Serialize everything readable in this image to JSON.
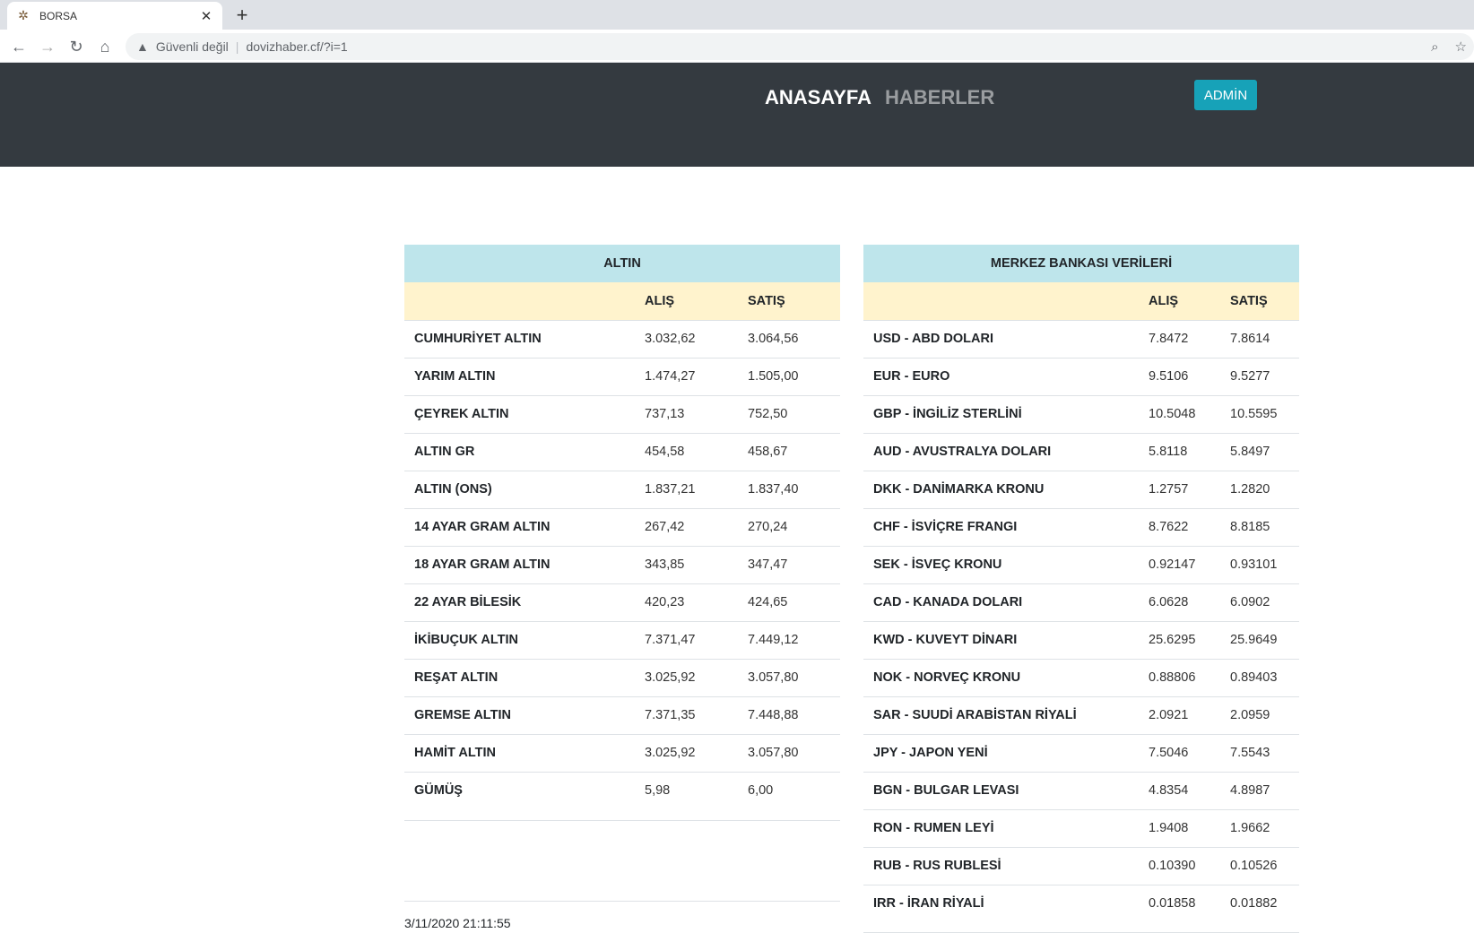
{
  "browser": {
    "tab_title": "BORSA",
    "security_label": "Güvenli değil",
    "url": "dovizhaber.cf/?i=1"
  },
  "nav": {
    "home": "ANASAYFA",
    "news": "HABERLER",
    "admin": "ADMİN"
  },
  "gold": {
    "title": "ALTIN",
    "buy_header": "ALIŞ",
    "sell_header": "SATIŞ",
    "rows": [
      {
        "name": "CUMHURİYET ALTIN",
        "buy": "3.032,62",
        "sell": "3.064,56"
      },
      {
        "name": "YARIM ALTIN",
        "buy": "1.474,27",
        "sell": "1.505,00"
      },
      {
        "name": "ÇEYREK ALTIN",
        "buy": "737,13",
        "sell": "752,50"
      },
      {
        "name": "ALTIN GR",
        "buy": "454,58",
        "sell": "458,67"
      },
      {
        "name": "ALTIN (ONS)",
        "buy": "1.837,21",
        "sell": "1.837,40"
      },
      {
        "name": "14 AYAR GRAM ALTIN",
        "buy": "267,42",
        "sell": "270,24"
      },
      {
        "name": "18 AYAR GRAM ALTIN",
        "buy": "343,85",
        "sell": "347,47"
      },
      {
        "name": "22 AYAR BİLESİK",
        "buy": "420,23",
        "sell": "424,65"
      },
      {
        "name": "İKİBUÇUK ALTIN",
        "buy": "7.371,47",
        "sell": "7.449,12"
      },
      {
        "name": "REŞAT ALTIN",
        "buy": "3.025,92",
        "sell": "3.057,80"
      },
      {
        "name": "GREMSE ALTIN",
        "buy": "7.371,35",
        "sell": "7.448,88"
      },
      {
        "name": "HAMİT ALTIN",
        "buy": "3.025,92",
        "sell": "3.057,80"
      },
      {
        "name": "GÜMÜŞ",
        "buy": "5,98",
        "sell": "6,00"
      }
    ],
    "timestamp": "3/11/2020 21:11:55"
  },
  "central_bank": {
    "title": "MERKEZ BANKASI VERİLERİ",
    "buy_header": "ALIŞ",
    "sell_header": "SATIŞ",
    "rows": [
      {
        "name": "USD - ABD DOLARI",
        "buy": "7.8472",
        "sell": "7.8614"
      },
      {
        "name": "EUR - EURO",
        "buy": "9.5106",
        "sell": "9.5277"
      },
      {
        "name": "GBP - İNGİLİZ STERLİNİ",
        "buy": "10.5048",
        "sell": "10.5595"
      },
      {
        "name": "AUD - AVUSTRALYA DOLARI",
        "buy": "5.8118",
        "sell": "5.8497"
      },
      {
        "name": "DKK - DANİMARKA KRONU",
        "buy": "1.2757",
        "sell": "1.2820"
      },
      {
        "name": "CHF - İSVİÇRE FRANGI",
        "buy": "8.7622",
        "sell": "8.8185"
      },
      {
        "name": "SEK - İSVEÇ KRONU",
        "buy": "0.92147",
        "sell": "0.93101"
      },
      {
        "name": "CAD - KANADA DOLARI",
        "buy": "6.0628",
        "sell": "6.0902"
      },
      {
        "name": "KWD - KUVEYT DİNARI",
        "buy": "25.6295",
        "sell": "25.9649"
      },
      {
        "name": "NOK - NORVEÇ KRONU",
        "buy": "0.88806",
        "sell": "0.89403"
      },
      {
        "name": "SAR - SUUDİ ARABİSTAN RİYALİ",
        "buy": "2.0921",
        "sell": "2.0959"
      },
      {
        "name": "JPY - JAPON YENİ",
        "buy": "7.5046",
        "sell": "7.5543"
      },
      {
        "name": "BGN - BULGAR LEVASI",
        "buy": "4.8354",
        "sell": "4.8987"
      },
      {
        "name": "RON - RUMEN LEYİ",
        "buy": "1.9408",
        "sell": "1.9662"
      },
      {
        "name": "RUB - RUS RUBLESİ",
        "buy": "0.10390",
        "sell": "0.10526"
      },
      {
        "name": "IRR - İRAN RİYALİ",
        "buy": "0.01858",
        "sell": "0.01882"
      }
    ]
  }
}
